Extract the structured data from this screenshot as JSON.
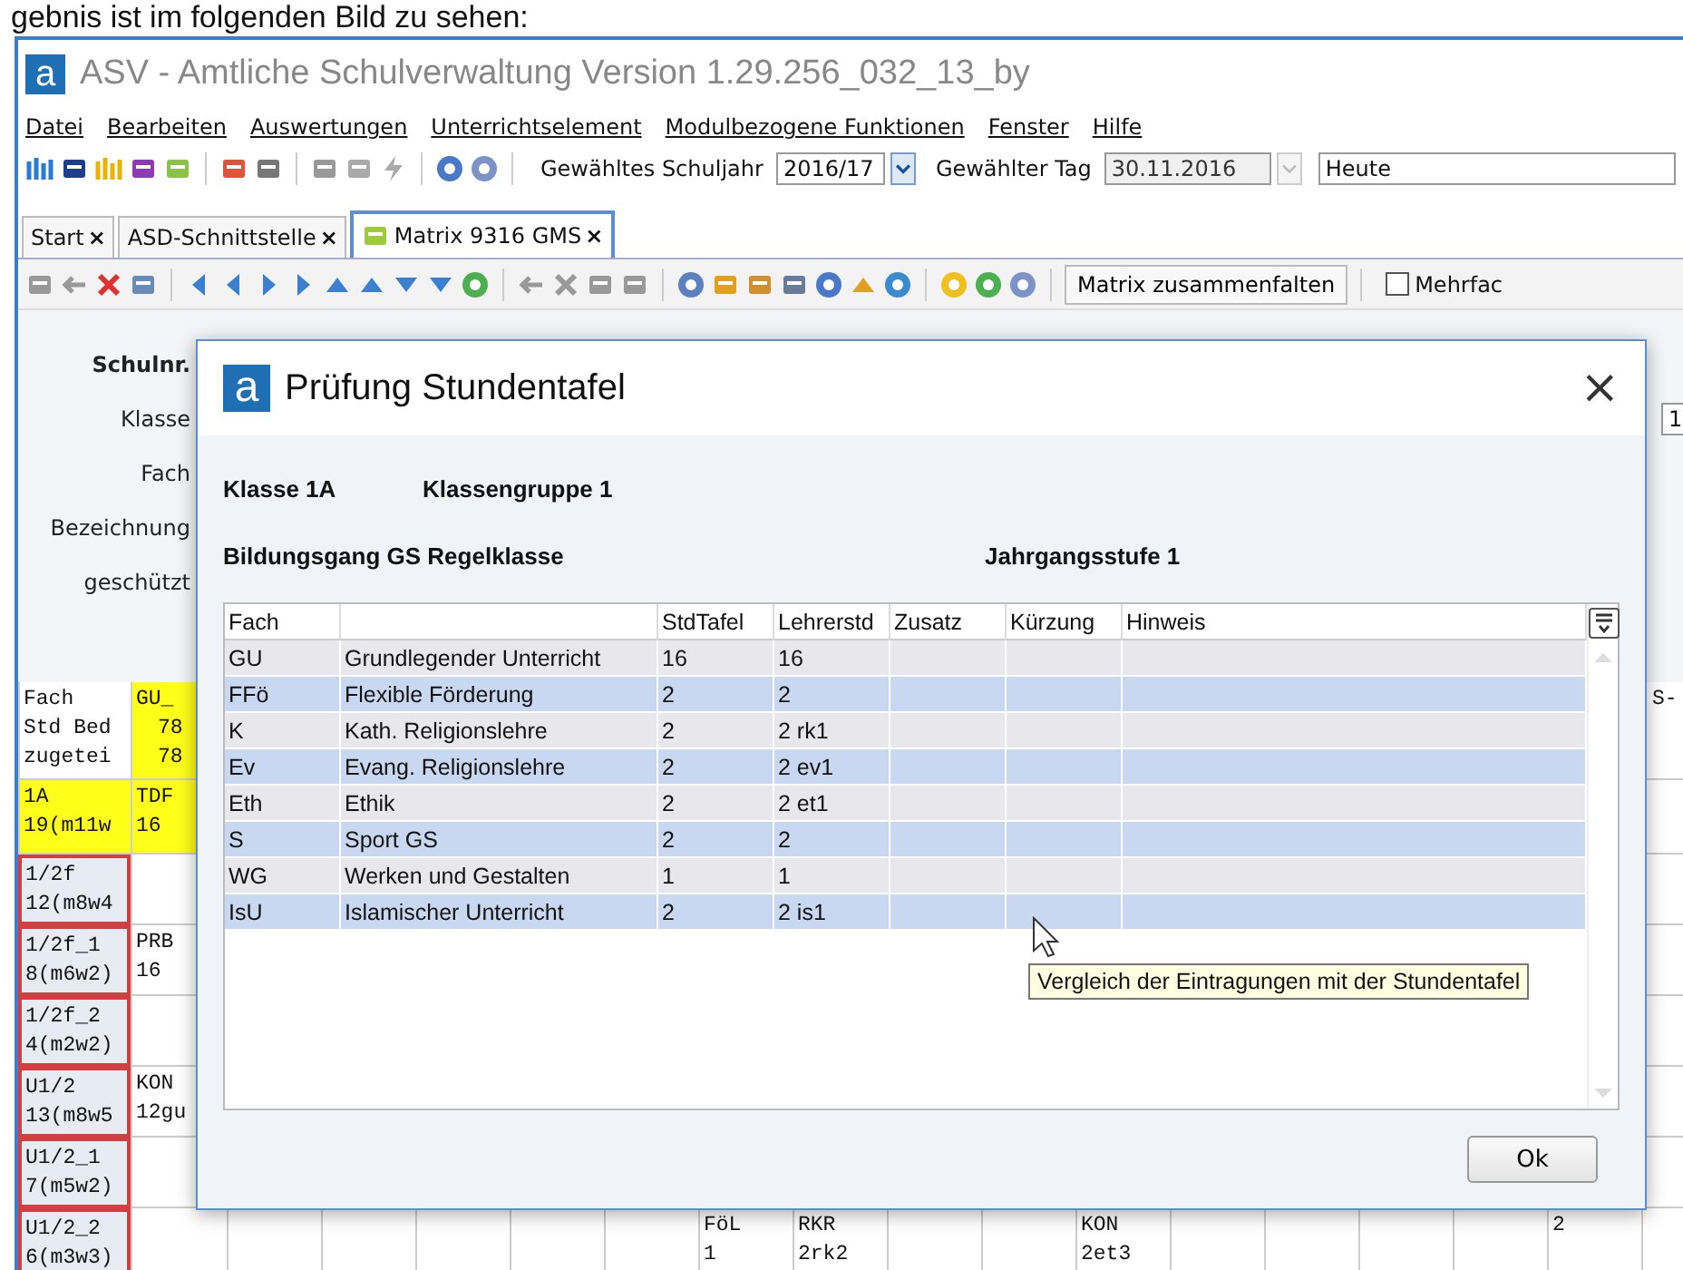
{
  "caption": "gebnis ist im folgenden Bild zu sehen:",
  "window": {
    "logo": "a",
    "title": "ASV - Amtliche Schulverwaltung Version 1.29.256_032_13_by"
  },
  "menu": [
    "Datei",
    "Bearbeiten",
    "Auswertungen",
    "Unterrichtselement",
    "Modulbezogene Funktionen",
    "Fenster",
    "Hilfe"
  ],
  "toolbar": {
    "schuljahr_label": "Gewähltes Schuljahr",
    "schuljahr": "2016/17",
    "tag_label": "Gewählter Tag",
    "tag": "30.11.2016",
    "heute": "Heute"
  },
  "tabs": [
    {
      "label": "Start",
      "close": "×",
      "selected": false
    },
    {
      "label": "ASD-Schnittstelle",
      "close": "×",
      "selected": false
    },
    {
      "label": "Matrix 9316 GMS",
      "close": "×",
      "selected": true
    }
  ],
  "toolbar2": {
    "collapse_button": "Matrix zusammenfalten",
    "checkbox_label": "Mehrfac",
    "checked": false
  },
  "form": {
    "labels": [
      "Schulnr.",
      "Klasse",
      "Fach",
      "Bezeichnung",
      "geschützt"
    ],
    "klasse_field_value": "1"
  },
  "matrix": {
    "header": {
      "label": [
        "Fach",
        "Std Bed",
        "zugetei"
      ],
      "first": [
        "GU_",
        "78",
        "78"
      ],
      "last": "S-"
    },
    "rows": [
      {
        "kind": "class",
        "label": [
          "1A",
          "19(m11w"
        ],
        "first": [
          "TDF",
          "16"
        ],
        "cells": []
      },
      {
        "kind": "group",
        "label": [
          "1/2f",
          "12(m8w4"
        ],
        "first": null,
        "cells": []
      },
      {
        "kind": "group",
        "label": [
          "1/2f_1",
          "8(m6w2)"
        ],
        "first": [
          "PRB",
          "16"
        ],
        "cells": []
      },
      {
        "kind": "group",
        "label": [
          "1/2f_2",
          "4(m2w2)"
        ],
        "first": null,
        "cells": []
      },
      {
        "kind": "group",
        "label": [
          "U1/2",
          "13(m8w5"
        ],
        "first": [
          "KON",
          "12gu"
        ],
        "cells": []
      },
      {
        "kind": "group",
        "label": [
          "U1/2_1",
          "7(m5w2)"
        ],
        "first": null,
        "cells": []
      },
      {
        "kind": "group",
        "label": [
          "U1/2_2",
          "6(m3w3)"
        ],
        "first": null,
        "cells": [
          null,
          null,
          null,
          null,
          null,
          [
            "FöL",
            "1"
          ],
          [
            "RKR",
            "2rk2"
          ],
          null,
          null,
          [
            "KON",
            "2et3"
          ],
          null,
          null,
          null,
          null,
          [
            "2"
          ],
          null
        ]
      }
    ]
  },
  "dialog": {
    "logo": "a",
    "title": "Prüfung Stundentafel",
    "close": "×",
    "klasse": "Klasse 1A",
    "klassengruppe": "Klassengruppe 1",
    "bildungsgang": "Bildungsgang GS Regelklasse",
    "jahrgangsstufe": "Jahrgangsstufe 1",
    "columns": [
      "Fach",
      "",
      "StdTafel",
      "Lehrerstd",
      "Zusatz",
      "Kürzung",
      "Hinweis"
    ],
    "rows": [
      [
        "GU",
        "Grundlegender Unterricht",
        "16",
        "16"
      ],
      [
        "FFö",
        "Flexible Förderung",
        "2",
        "2"
      ],
      [
        "K",
        "Kath. Religionslehre",
        "2",
        "2 rk1"
      ],
      [
        "Ev",
        "Evang. Religionslehre",
        "2",
        "2 ev1"
      ],
      [
        "Eth",
        "Ethik",
        "2",
        "2 et1"
      ],
      [
        "S",
        "Sport GS",
        "2",
        "2"
      ],
      [
        "WG",
        "Werken und Gestalten",
        "1",
        "1"
      ],
      [
        "IsU",
        "Islamischer Unterricht",
        "2",
        "2 is1"
      ]
    ],
    "tooltip": "Vergleich der Eintragungen mit der Stundentafel",
    "ok": "Ok"
  }
}
